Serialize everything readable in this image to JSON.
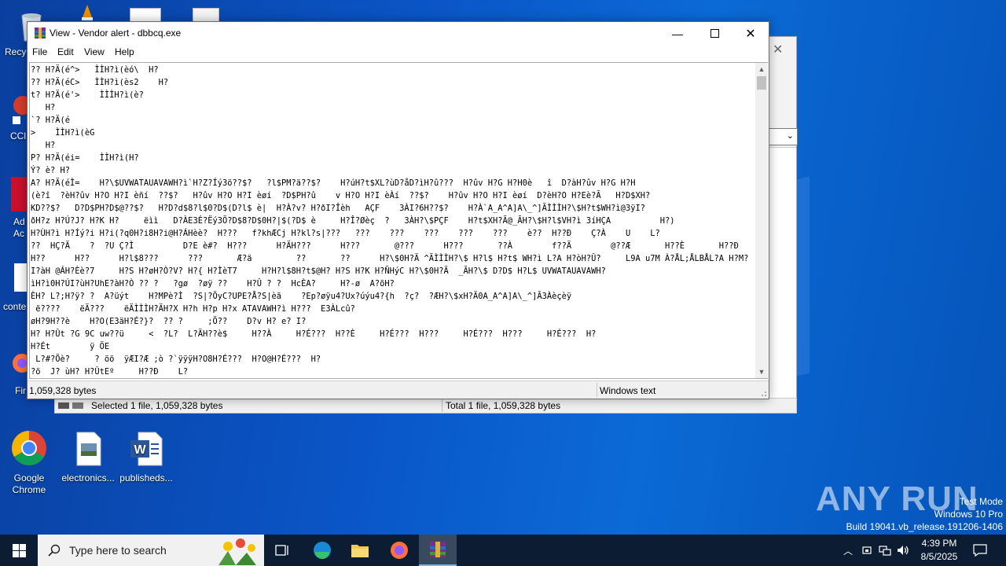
{
  "desktop": {
    "icons": [
      {
        "label": "Recy",
        "id": "recycle"
      },
      {
        "label": "CCl",
        "id": "ccleaner"
      },
      {
        "label": "Ad Ac",
        "id": "adobe"
      },
      {
        "label": "conte",
        "id": "conte"
      },
      {
        "label": "Fir",
        "id": "firefox-desk"
      }
    ],
    "bottom_icons": [
      {
        "label": "Google Chrome"
      },
      {
        "label": "electronics..."
      },
      {
        "label": "publisheds..."
      }
    ]
  },
  "window": {
    "title": "View - Vendor alert - dbbcq.exe",
    "menu": [
      "File",
      "Edit",
      "View",
      "Help"
    ],
    "content_lines": [
      "?? H?Ä(é^>   ÌÌH?ì(èó\\  H?",
      "?? H?Ä(éC>   ÌÌH?ì(ès2    H?",
      "t? H?Ä(é'>    ÌÌÌH?ì(è?",
      "   H?",
      "`? H?Ä(é",
      ">    ÌÌH?ì(èG",
      "   H?",
      "P? H?Ä(éi=    ÌÌH?ì(H?",
      "Ý? è? H?",
      "A? H?Ä(éÌ=    H?\\$UVWATAUAVAWH?ì`H?Z?Íý3ö??$?   ?l$PM?ä??$?    H?úH?t$XL?ùD?åD?ìH?û???  H?ûv H?G H?H0è   î  D?àH?ûv H?G H?H",
      "(è?î  ?èH?ûv H?O H?I èñí  ??$?   H?ûv H?O H?I èøí  ?D$PH?û    v H?O H?I èÀí  ??$?    H?ûv H?O H?I èøí  D?èH?O H?Eè?Ã   H?D$XH?",
      "KD??$?   D?D$PH?D$@??$?   H?D?d$8?l$0?D$(D?l$ è|  H?À?v? H?ðI?Îèh   AÇF    3ÀI?6H??$?    H?À`A_A^A]A\\_^]ÃÌÌÌH?\\$H?t$WH?ì@3ÿI?",
      "ðH?z H?Ú?J? H?K H?     ëìì   D?ÀE3É?Ëý3Ö?D$8?D$0H?|$(?D$ è     H?Î?Øèç  ?   3ÀH?\\$PÇF    H?t$XH?Ä@_ÃH?\\$H?l$VH?ì 3íHÇA          H?)",
      "H?ÙH?ì H?Íý?i H?i(?q0H?i8H?i@H?ÁHèè?  H???   f?khÆCj H?kl?s|???   ???    ???    ???    ???    ???    è??  H??Ð    Ç?À    U    L?",
      "??  HÇ?Ä    ?  ?U Ç?Ì          D?E è#?  H???      H?ÄH???      H???       @???      H???       ??À        f??Ä        @??Æ       H??È       H??Ð        H??Ø        H??è        H??ä        ?? ",
      "H??      H??      H?l$8???      ???       Æ?ä         ??       ??      H?\\$0H?Ä ^ÃÌÌÌH?\\$ H?l$ H?t$ WH?ì L?A H?òH?Û?     L9A u7M À?ÅL;ÅLBÅL?A H?M?",
      "I?àH @ÁH?Èè?7     H?S H?øH?Ò?V? H?{ H?ÌèT7     H?H?l$8H?t$@H? H?S H?K H?ÑHýC H?\\$0H?Ä  _ÃH?\\$ D?D$ H?L$ UVWATAUAVAWH?",
      "ìH?ì0H?ÚI?ùH?UhE?àH?Ò ?? ?   ?gø  ?øÿ ??    H?Û ? ?  HcÈA?     H?-ø  A?õH?",
      "ÈH? L?;H?ÿ? ?  A?üýt    H?MPè?Ì  ?S|?ÖyC?UPE?Å?S|èã    ?Ep?øÿu4?Ux?úýu4?{h  ?ç?  ?ÆH?\\$xH?Ä0A_A^A]A\\_^]Ã3Àèçèÿ",
      " ë????    ëÄ???    ëÄÌÌÌH?ÄH?X H?h H?p H?x ATAVAWH?ì H???  E3ÀLcû?",
      "øH?9H??è    H?O(E3äH?É?}?  ?? ?     ;Ö??    D?v H? e? I?",
      "H? H?Ût ?G 9C uw??ü     <  ?L?  L?ÄH??è$     H??À     H?É???  H??È     H?É???  H???     H?É???  H???     H?É???  H?",
      "H?Ét        ÿ ÖE",
      " L?#?Öè?     ? öö  ÿÆI?Æ ;ò ?`ÿÿÿH?O8H?É???  H?O@H?É???  H?",
      "?ö  J? ùH? H?ÛtEº     H??Ð    L?"
    ],
    "status_left": "1,059,328 bytes",
    "status_right": "Windows text"
  },
  "behind_window": {
    "status_left": "Selected 1 file, 1,059,328 bytes",
    "status_right": "Total 1 file, 1,059,328 bytes"
  },
  "watermark": {
    "brand": "ANY RUN",
    "line1": "Test Mode",
    "line2": "Windows 10 Pro",
    "line3": "Build 19041.vb_release.191206-1406"
  },
  "taskbar": {
    "search_placeholder": "Type here to search",
    "time": "4:39 PM",
    "date": "8/5/2025"
  },
  "colors": {
    "desktop": "#0a56c8",
    "taskbar": "#0c1d33",
    "active_indicator": "#76b9ed"
  }
}
